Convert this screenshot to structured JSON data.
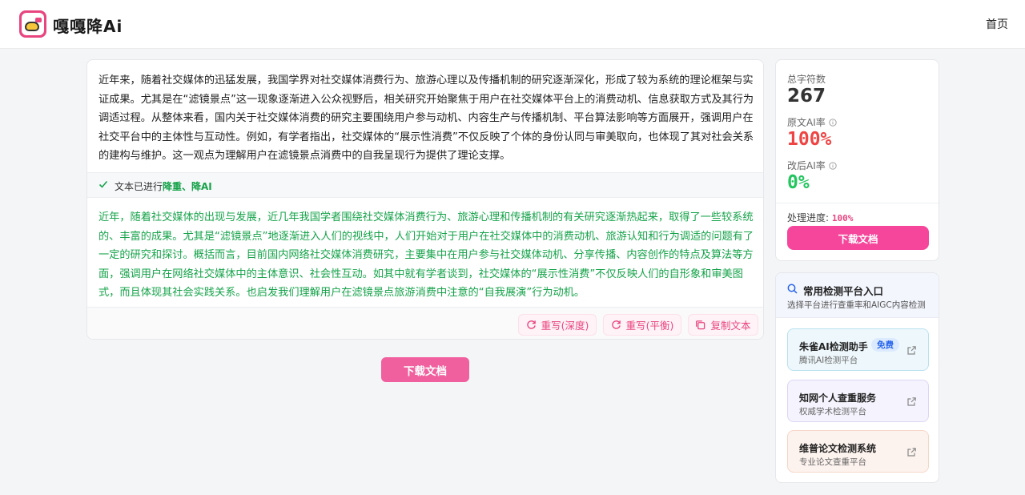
{
  "header": {
    "brand": "嘎嘎降Ai",
    "nav_home": "首页"
  },
  "editor": {
    "original_text": "近年来，随着社交媒体的迅猛发展，我国学界对社交媒体消费行为、旅游心理以及传播机制的研究逐渐深化，形成了较为系统的理论框架与实证成果。尤其是在“滤镜景点”这一现象逐渐进入公众视野后，相关研究开始聚焦于用户在社交媒体平台上的消费动机、信息获取方式及其行为调适过程。从整体来看，国内关于社交媒体消费的研究主要围绕用户参与动机、内容生产与传播机制、平台算法影响等方面展开，强调用户在社交平台中的主体性与互动性。例如，有学者指出，社交媒体的“展示性消费”不仅反映了个体的身份认同与审美取向，也体现了其对社会关系的建构与维护。这一观点为理解用户在滤镜景点消费中的自我呈现行为提供了理论支撑。",
    "status_prefix": "文本已进行",
    "status_highlight": "降重、降AI",
    "rewritten_text": "近年，随着社交媒体的出现与发展，近几年我国学者围绕社交媒体消费行为、旅游心理和传播机制的有关研究逐渐热起来，取得了一些较系统的、丰富的成果。尤其是“滤镜景点”地逐渐进入人们的视线中，人们开始对于用户在社交媒体中的消费动机、旅游认知和行为调适的问题有了一定的研究和探讨。概括而言，目前国内网络社交媒体消费研究，主要集中在用户参与社交媒体动机、分享传播、内容创作的特点及算法等方面，强调用户在网络社交媒体中的主体意识、社会性互动。如其中就有学者谈到，社交媒体的“展示性消费”不仅反映人们的自形象和审美图式，而且体现其社会实践关系。也启发我们理解用户在滤镜景点旅游消费中注意的“自我展演”行为动机。",
    "btn_rewrite_deep": "重写(深度)",
    "btn_rewrite_balanced": "重写(平衡)",
    "btn_copy": "复制文本"
  },
  "download_main_label": "下载文档",
  "stats": {
    "total_label": "总字符数",
    "total_value": "267",
    "orig_ai_label": "原文AI率",
    "orig_ai_value": "100%",
    "new_ai_label": "改后AI率",
    "new_ai_value": "0%",
    "progress_label": "处理进度: ",
    "progress_value": "100%",
    "progress_fraction": 1.0,
    "download_label": "下载文档"
  },
  "platforms": {
    "title": "常用检测平台入口",
    "subtitle": "选择平台进行查重率和AIGC内容检测",
    "items": [
      {
        "name": "朱雀AI检测助手",
        "badge": "免费",
        "desc": "腾讯AI检测平台"
      },
      {
        "name": "知网个人查重服务",
        "desc": "权威学术检测平台"
      },
      {
        "name": "维普论文检测系统",
        "desc": "专业论文查重平台"
      }
    ]
  },
  "colors": {
    "accent_pink": "#f0609e",
    "ai_red": "#ef4444",
    "ai_green": "#22c55e",
    "rewritten_text": "#16a34a"
  },
  "icons": {
    "logo": "duck-logo-icon",
    "check": "check-icon",
    "refresh": "refresh-icon",
    "copy": "copy-icon",
    "info": "info-icon",
    "search": "search-icon",
    "external": "external-link-icon"
  }
}
